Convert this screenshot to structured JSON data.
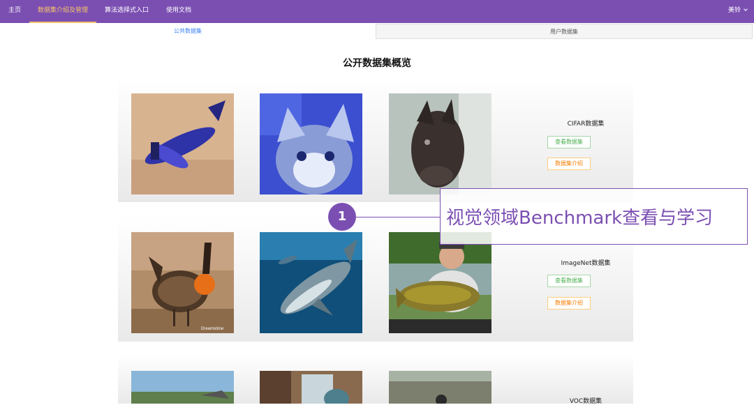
{
  "nav": {
    "items": [
      "主页",
      "数据集介绍及管理",
      "算法选择式入口",
      "使用文档"
    ],
    "active_index": 1,
    "user": "美铃"
  },
  "tabs": {
    "public": "公共数据集",
    "user": "用户数据集"
  },
  "page_title": "公开数据集概览",
  "datasets": [
    {
      "name": "CIFAR数据集",
      "view_label": "查看数据集",
      "intro_label": "数据集介绍",
      "thumbs": [
        "airplane",
        "cat",
        "horse"
      ]
    },
    {
      "name": "ImageNet数据集",
      "view_label": "查看数据集",
      "intro_label": "数据集介绍",
      "thumbs": [
        "prairie-chicken",
        "shark",
        "fish"
      ]
    },
    {
      "name": "VOC数据集",
      "thumbs": [
        "road",
        "room",
        "street"
      ]
    }
  ],
  "annotation": {
    "number": "1",
    "text": "视觉领域Benchmark查看与学习"
  },
  "colors": {
    "brand": "#7b4fb2",
    "active_nav": "#f6c26b",
    "view_button": "#4caf50",
    "intro_button": "#f57c00"
  }
}
